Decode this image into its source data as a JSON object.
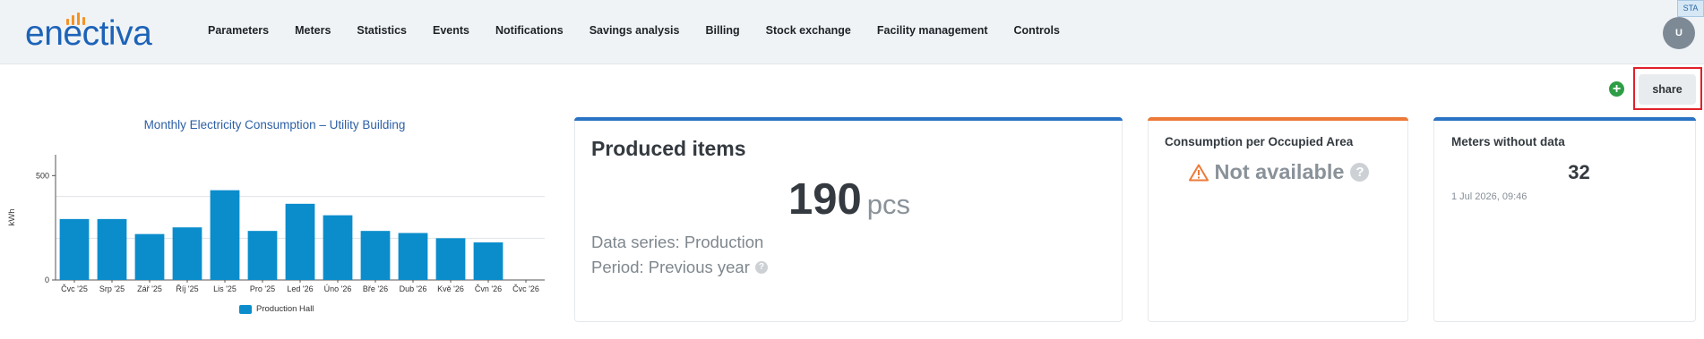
{
  "app": {
    "logo_text": "enectiva",
    "env_badge": "STA",
    "user_initial": "U"
  },
  "nav": {
    "items": [
      {
        "label": "Parameters"
      },
      {
        "label": "Meters"
      },
      {
        "label": "Statistics"
      },
      {
        "label": "Events"
      },
      {
        "label": "Notifications"
      },
      {
        "label": "Savings analysis"
      },
      {
        "label": "Billing"
      },
      {
        "label": "Stock exchange"
      },
      {
        "label": "Facility management"
      },
      {
        "label": "Controls"
      }
    ]
  },
  "toolbar": {
    "add_icon": "plus-circle-icon",
    "add_symbol": "+",
    "share_label": "share"
  },
  "chart_data": {
    "type": "bar",
    "title": "Monthly Electricity Consumption – Utility Building",
    "ylabel": "kWh",
    "xlabel": "",
    "categories": [
      "Čvc '25",
      "Srp '25",
      "Zář '25",
      "Říj '25",
      "Lis '25",
      "Pro '25",
      "Led '26",
      "Úno '26",
      "Bře '26",
      "Dub '26",
      "Kvě '26",
      "Čvn '26",
      "Čvc '26"
    ],
    "series": [
      {
        "name": "Production Hall",
        "color": "#0b8dcc",
        "values": [
          292,
          292,
          220,
          252,
          430,
          235,
          365,
          310,
          235,
          225,
          200,
          180,
          null
        ]
      }
    ],
    "ylim": [
      0,
      600
    ],
    "yticks": [
      0,
      500
    ],
    "grid": true,
    "legend_position": "bottom"
  },
  "cards": {
    "produced": {
      "title": "Produced items",
      "value": "190",
      "unit": "pcs",
      "series_text": "Data series: Production",
      "period_text": "Period: Previous year",
      "help_symbol": "?",
      "accent": "#2a73c4"
    },
    "consumption": {
      "title": "Consumption per Occupied Area",
      "status_text": "Not available",
      "help_symbol": "?",
      "warning_icon": "warning-triangle-icon",
      "accent": "#ec7a39"
    },
    "meters": {
      "title": "Meters without data",
      "value": "32",
      "timestamp": "1 Jul 2026, 09:46",
      "accent": "#2a73c4"
    }
  }
}
